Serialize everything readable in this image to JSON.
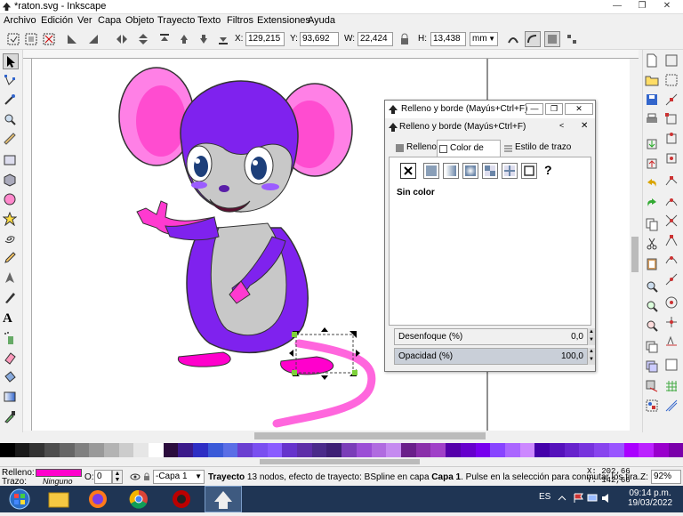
{
  "window": {
    "title": "*raton.svg - Inkscape",
    "controls": [
      "minimize",
      "restore",
      "close"
    ]
  },
  "menu": [
    "Archivo",
    "Edición",
    "Ver",
    "Capa",
    "Objeto",
    "Trayecto",
    "Texto",
    "Filtros",
    "Extensiones",
    "Ayuda"
  ],
  "controls": {
    "x_label": "X:",
    "x_value": "129,215",
    "y_label": "Y:",
    "y_value": "93,692",
    "w_label": "W:",
    "w_value": "22,424",
    "h_label": "H:",
    "h_value": "13,438",
    "unit": "mm"
  },
  "tools": [
    "selector-icon",
    "node-icon",
    "tweak-icon",
    "zoom-icon",
    "measure-icon",
    "rectangle-icon",
    "box3d-icon",
    "ellipse-icon",
    "star-icon",
    "spiral-icon",
    "pencil-icon",
    "pen-icon",
    "calligraphy-icon",
    "text-icon",
    "spray-icon",
    "eraser-icon",
    "bucket-icon",
    "gradient-icon",
    "dropper-icon"
  ],
  "fill_stroke_dialog": {
    "title": "Relleno y borde (Mayús+Ctrl+F)",
    "header": "Relleno y borde (Mayús+Ctrl+F)",
    "tabs": [
      "Relleno",
      "Color de trazo",
      "Estilo de trazo"
    ],
    "active_tab": "Color de trazo",
    "paint_buttons": [
      "no-paint-icon",
      "flat-color-icon",
      "linear-gradient-icon",
      "radial-gradient-icon",
      "mesh-gradient-icon",
      "pattern-icon",
      "swatch-icon",
      "unset-icon"
    ],
    "unset_label": "?",
    "current_paint": "Sin color",
    "blur_label": "Desenfoque (%)",
    "blur_value": "0,0",
    "opacity_label": "Opacidad (%)",
    "opacity_value": "100,0"
  },
  "palette_colors": [
    "#000000",
    "#1a1a1a",
    "#333333",
    "#4d4d4d",
    "#666666",
    "#808080",
    "#999999",
    "#b3b3b3",
    "#cccccc",
    "#e6e6e6",
    "#ffffff",
    "#2b0d3d",
    "#3b1a8a",
    "#2e2ec4",
    "#3a5ad8",
    "#5a6ee6",
    "#6a3fd1",
    "#7a4ff0",
    "#8a5cff",
    "#6633cc",
    "#5d2ea8",
    "#4a2a8a",
    "#3d1f75",
    "#7a3db8",
    "#9b4ed6",
    "#b06be0",
    "#c58af0",
    "#6a1f8a",
    "#8a2faa",
    "#a040c8",
    "#5500aa",
    "#6600cc",
    "#7700ee",
    "#8844ff",
    "#aa66ff",
    "#cc88ff",
    "#4400aa",
    "#5511bb",
    "#6622cc",
    "#7733dd",
    "#8844ee",
    "#9955ff",
    "#aa00ff",
    "#bb22ff",
    "#9900cc",
    "#7a00aa"
  ],
  "status": {
    "fill_label": "Relleno:",
    "fill_color": "#ff00cc",
    "stroke_label": "Trazo:",
    "stroke_value": "Ninguno",
    "opacity_label": "O:",
    "opacity_value": "0",
    "layer": "-Capa 1",
    "message_bold": "Trayecto",
    "message": "13 nodos, efecto de trayecto: BSpline en capa",
    "message_layer": "Capa 1",
    "message_tail": ". Pulse en la selección para conmutar los tira...",
    "x_label": "X:",
    "x_value": "202,66",
    "y_label": "Y:",
    "y_value": "142,66",
    "zoom_label": "Z:",
    "zoom_value": "92%"
  },
  "taskbar": {
    "lang": "ES",
    "time": "09:14 p.m.",
    "date": "19/03/2022"
  },
  "colors": {
    "body": "#7f22ee",
    "belly": "#c8c8c8",
    "ear_outer": "#ff66dd",
    "ear_inner": "#ff33cc",
    "pink": "#ff00cc",
    "dark_pink": "#e600b8"
  }
}
